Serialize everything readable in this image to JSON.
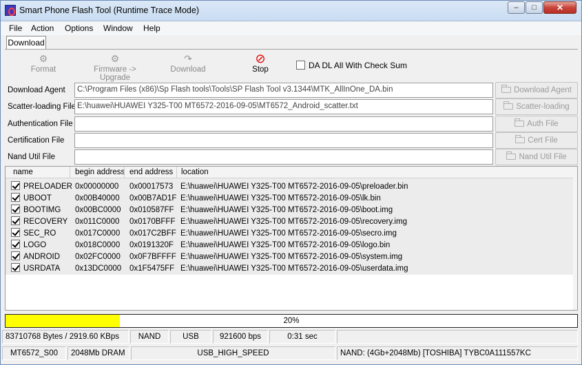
{
  "window": {
    "title": "Smart Phone Flash Tool (Runtime Trace Mode)",
    "min": "–",
    "max": "□",
    "close": "✕"
  },
  "menu": {
    "items": [
      "File",
      "Action",
      "Options",
      "Window",
      "Help"
    ]
  },
  "tabs": {
    "active": "Download"
  },
  "toolbar": {
    "format": "Format",
    "firmware_upgrade": "Firmware -> Upgrade",
    "download": "Download",
    "stop": "Stop",
    "checksum_label": "DA DL All With Check Sum",
    "checksum_checked": false
  },
  "files": [
    {
      "label": "Download Agent",
      "value": "C:\\Program Files (x86)\\Sp Flash tools\\Tools\\SP Flash Tool v3.1344\\MTK_AllInOne_DA.bin",
      "button": "Download Agent"
    },
    {
      "label": "Scatter-loading File",
      "value": "E:\\huawei\\HUAWEI Y325-T00 MT6572-2016-09-05\\MT6572_Android_scatter.txt",
      "button": "Scatter-loading"
    },
    {
      "label": "Authentication File",
      "value": "",
      "button": "Auth File"
    },
    {
      "label": "Certification File",
      "value": "",
      "button": "Cert File"
    },
    {
      "label": "Nand Util File",
      "value": "",
      "button": "Nand Util File"
    }
  ],
  "table": {
    "headers": [
      "name",
      "begin address",
      "end address",
      "location"
    ],
    "rows": [
      {
        "checked": true,
        "name": "PRELOADER",
        "begin": "0x00000000",
        "end": "0x00017573",
        "location": "E:\\huawei\\HUAWEI Y325-T00 MT6572-2016-09-05\\preloader.bin"
      },
      {
        "checked": true,
        "name": "UBOOT",
        "begin": "0x00B40000",
        "end": "0x00B7AD1F",
        "location": "E:\\huawei\\HUAWEI Y325-T00 MT6572-2016-09-05\\lk.bin"
      },
      {
        "checked": true,
        "name": "BOOTIMG",
        "begin": "0x00BC0000",
        "end": "0x010587FF",
        "location": "E:\\huawei\\HUAWEI Y325-T00 MT6572-2016-09-05\\boot.img"
      },
      {
        "checked": true,
        "name": "RECOVERY",
        "begin": "0x011C0000",
        "end": "0x0170BFFF",
        "location": "E:\\huawei\\HUAWEI Y325-T00 MT6572-2016-09-05\\recovery.img"
      },
      {
        "checked": true,
        "name": "SEC_RO",
        "begin": "0x017C0000",
        "end": "0x017C2BFF",
        "location": "E:\\huawei\\HUAWEI Y325-T00 MT6572-2016-09-05\\secro.img"
      },
      {
        "checked": true,
        "name": "LOGO",
        "begin": "0x018C0000",
        "end": "0x0191320F",
        "location": "E:\\huawei\\HUAWEI Y325-T00 MT6572-2016-09-05\\logo.bin"
      },
      {
        "checked": true,
        "name": "ANDROID",
        "begin": "0x02FC0000",
        "end": "0x0F7BFFFF",
        "location": "E:\\huawei\\HUAWEI Y325-T00 MT6572-2016-09-05\\system.img"
      },
      {
        "checked": true,
        "name": "USRDATA",
        "begin": "0x13DC0000",
        "end": "0x1F5475FF",
        "location": "E:\\huawei\\HUAWEI Y325-T00 MT6572-2016-09-05\\userdata.img"
      }
    ]
  },
  "progress": {
    "percent": 20,
    "text": "20%",
    "color": "#ffff00"
  },
  "status1": {
    "transfer": "83710768 Bytes / 2919.60 KBps",
    "storage": "NAND",
    "port": "USB",
    "baud": "921600 bps",
    "time": "0:31 sec"
  },
  "status2": {
    "chip": "MT6572_S00",
    "dram": "2048Mb DRAM",
    "usb_speed": "USB_HIGH_SPEED",
    "nand_info": "NAND: (4Gb+2048Mb) [TOSHIBA] TYBC0A111557KC"
  }
}
